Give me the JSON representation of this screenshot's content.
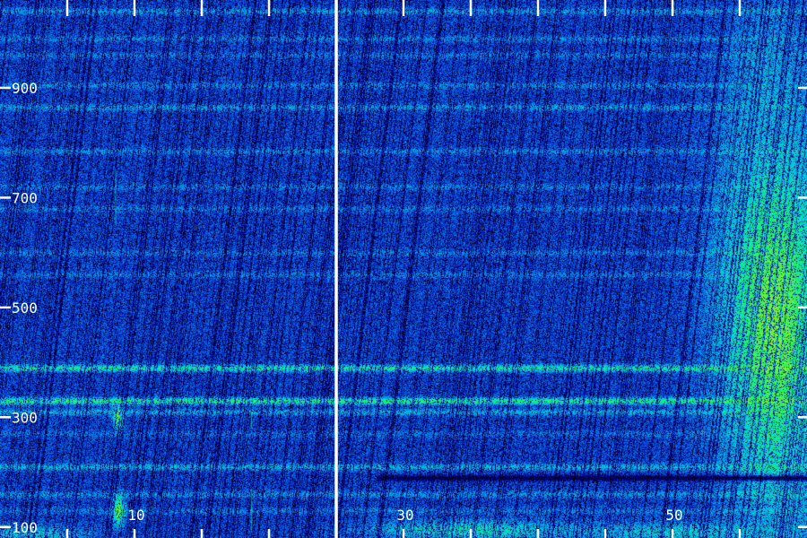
{
  "chart_data": {
    "type": "heatmap",
    "title": "",
    "xlabel": "",
    "ylabel": "",
    "xlim": [
      0,
      60
    ],
    "ylim": [
      80,
      1060
    ],
    "grid": false,
    "x_ticks": [
      {
        "value": 0
      },
      {
        "value": 5
      },
      {
        "value": 10,
        "label": "10"
      },
      {
        "value": 15
      },
      {
        "value": 20
      },
      {
        "value": 25
      },
      {
        "value": 30,
        "label": "30"
      },
      {
        "value": 35
      },
      {
        "value": 40
      },
      {
        "value": 45
      },
      {
        "value": 50,
        "label": "50"
      },
      {
        "value": 55
      }
    ],
    "y_ticks": [
      {
        "value": 100,
        "label": "100"
      },
      {
        "value": 300,
        "label": "300"
      },
      {
        "value": 500,
        "label": "500"
      },
      {
        "value": 700,
        "label": "700"
      },
      {
        "value": 900,
        "label": "900"
      }
    ],
    "divider_x": 25,
    "colormap": [
      "#000010",
      "#00007a",
      "#0b3dd6",
      "#05a6e6",
      "#05e0c8",
      "#22f060",
      "#9cf020"
    ],
    "background_level": 0.34,
    "horizontal_bands": [
      {
        "y": 1040,
        "level": 0.5
      },
      {
        "y": 990,
        "level": 0.46
      },
      {
        "y": 960,
        "level": 0.44
      },
      {
        "y": 905,
        "level": 0.46
      },
      {
        "y": 865,
        "level": 0.5
      },
      {
        "y": 785,
        "level": 0.46
      },
      {
        "y": 720,
        "level": 0.44
      },
      {
        "y": 680,
        "level": 0.44
      },
      {
        "y": 600,
        "level": 0.44
      },
      {
        "y": 560,
        "level": 0.44
      },
      {
        "y": 390,
        "level": 0.74
      },
      {
        "y": 330,
        "level": 0.8
      },
      {
        "y": 310,
        "level": 0.54
      },
      {
        "y": 270,
        "level": 0.42
      },
      {
        "y": 210,
        "level": 0.56
      },
      {
        "y": 160,
        "level": 0.48
      },
      {
        "y": 130,
        "level": 0.44
      }
    ],
    "dark_bands": [
      {
        "y": 190,
        "x_start": 28,
        "x_end": 60,
        "level": 0.1
      }
    ],
    "hotspots": [
      {
        "x": 57.5,
        "y": 480,
        "sx": 2.6,
        "sy": 230,
        "level": 0.95
      },
      {
        "x": 57.0,
        "y": 850,
        "sx": 1.8,
        "sy": 140,
        "level": 0.55
      },
      {
        "x": 8.8,
        "y": 300,
        "sx": 0.25,
        "sy": 14,
        "level": 0.95
      },
      {
        "x": 8.8,
        "y": 130,
        "sx": 0.3,
        "sy": 18,
        "level": 0.95
      },
      {
        "x": 35,
        "y": 95,
        "sx": 5,
        "sy": 12,
        "level": 0.7
      },
      {
        "x": 2,
        "y": 88,
        "sx": 3,
        "sy": 10,
        "level": 0.62
      },
      {
        "x": 51,
        "y": 92,
        "sx": 6,
        "sy": 12,
        "level": 0.62
      }
    ],
    "faint_lines": [
      {
        "x": 8.6,
        "y_from": 650,
        "y_to": 750
      },
      {
        "x": 18.7,
        "y_from": 90,
        "y_to": 170
      },
      {
        "x": 18.7,
        "y_from": 280,
        "y_to": 310
      }
    ]
  }
}
